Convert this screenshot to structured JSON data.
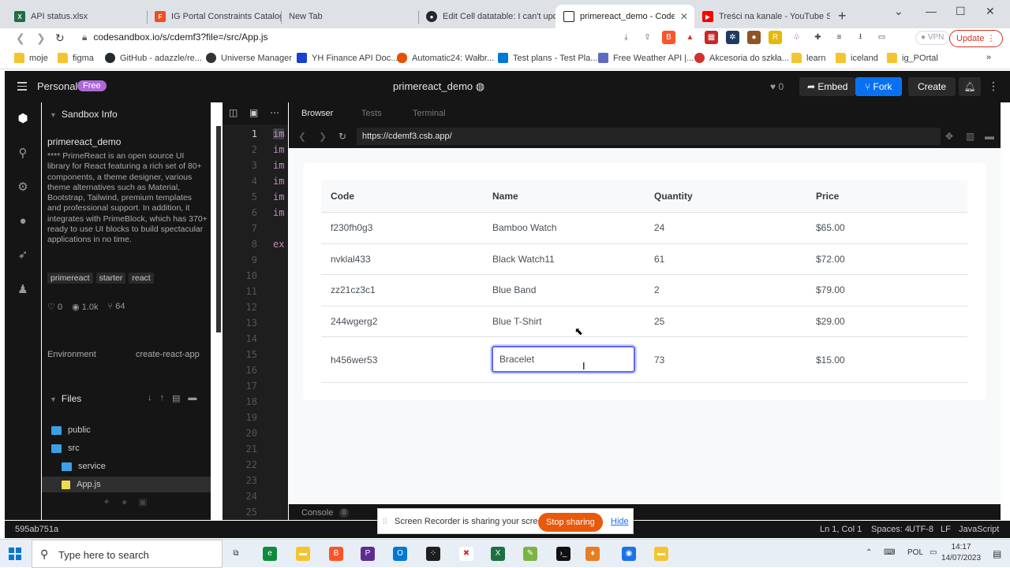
{
  "browser": {
    "tabs": [
      {
        "label": "API status.xlsx",
        "icon": "excel-icon",
        "color": "#1d6f42"
      },
      {
        "label": "IG Portal Constraints Catalog",
        "icon": "figma-icon",
        "color": "#f24e1e"
      },
      {
        "label": "New Tab",
        "icon": "",
        "color": ""
      },
      {
        "label": "Edit Cell datatable: I can't updat",
        "icon": "github-icon",
        "color": "#24292f"
      },
      {
        "label": "primereact_demo - CodeSa",
        "icon": "codesandbox-icon",
        "color": "#151515"
      },
      {
        "label": "Treści na kanale - YouTube Studi",
        "icon": "youtube-icon",
        "color": "#ff0000"
      }
    ],
    "new_tab": "+",
    "address": "codesandbox.io/s/cdemf3?file=/src/App.js",
    "vpn": "VPN",
    "update": "Update",
    "bookmarks": [
      "moje",
      "figma",
      "GitHub - adazzle/re...",
      "Universe Manager",
      "YH Finance API Doc...",
      "Automatic24: Wałbr...",
      "Test plans - Test Pla...",
      "Free Weather API |...",
      "Akcesoria do szkła...",
      "learn",
      "iceland",
      "ig_POrtal"
    ],
    "bookmarks_more": "»"
  },
  "csb": {
    "workspace": "Personal",
    "plan": "Free",
    "project_title": "primereact_demo",
    "likes": "0",
    "embed": "Embed",
    "fork": "Fork",
    "create": "Create"
  },
  "sidebar": {
    "section": "Sandbox Info",
    "name": "primereact_demo",
    "description": "**** PrimeReact is an open source UI library for React featuring a rich set of 80+ components, a theme designer, various theme alternatives such as Material, Bootstrap, Tailwind, premium templates and professional support. In addition, it integrates with PrimeBlock, which has 370+ ready to use UI blocks to build spectacular applications in no time.",
    "tags": [
      "primereact",
      "starter",
      "react"
    ],
    "stats": {
      "likes": "0",
      "views": "1.0k",
      "forks": "64"
    },
    "env_label": "Environment",
    "env_value": "create-react-app",
    "files_label": "Files",
    "tree": [
      "public",
      "src",
      "service",
      "App.js"
    ]
  },
  "editor": {
    "line_numbers": [
      "1",
      "2",
      "3",
      "4",
      "5",
      "6",
      "7",
      "8",
      "9",
      "10",
      "11",
      "12",
      "13",
      "14",
      "15",
      "16",
      "17",
      "18",
      "19",
      "20",
      "21",
      "22",
      "23",
      "24",
      "25"
    ],
    "code_lines": [
      "im",
      "im",
      "im",
      "im",
      "im",
      "im",
      "",
      "ex"
    ]
  },
  "preview": {
    "tabs": [
      "Browser",
      "Tests",
      "Terminal"
    ],
    "url": "https://cdemf3.csb.app/",
    "table": {
      "columns": [
        "Code",
        "Name",
        "Quantity",
        "Price"
      ],
      "rows": [
        [
          "f230fh0g3",
          "Bamboo Watch",
          "24",
          "$65.00"
        ],
        [
          "nvklal433",
          "Black Watch11",
          "61",
          "$72.00"
        ],
        [
          "zz21cz3c1",
          "Blue Band",
          "2",
          "$79.00"
        ],
        [
          "244wgerg2",
          "Blue T-Shirt",
          "25",
          "$29.00"
        ],
        [
          "h456wer53",
          "Bracelet",
          "73",
          "$15.00"
        ]
      ],
      "editing_value": "Bracelet"
    },
    "console": "Console",
    "console_count": "0"
  },
  "statusbar": {
    "hash": "595ab751a",
    "position": "Ln 1, Col 1",
    "spaces": "Spaces: 4",
    "encoding": "UTF-8",
    "eol": "LF",
    "language": "JavaScript"
  },
  "recorder": {
    "message": "Screen Recorder is sharing your screen.",
    "stop": "Stop sharing",
    "hide": "Hide"
  },
  "taskbar": {
    "search_placeholder": "Type here to search",
    "lang": "POL",
    "time": "14:17",
    "date": "14/07/2023"
  }
}
